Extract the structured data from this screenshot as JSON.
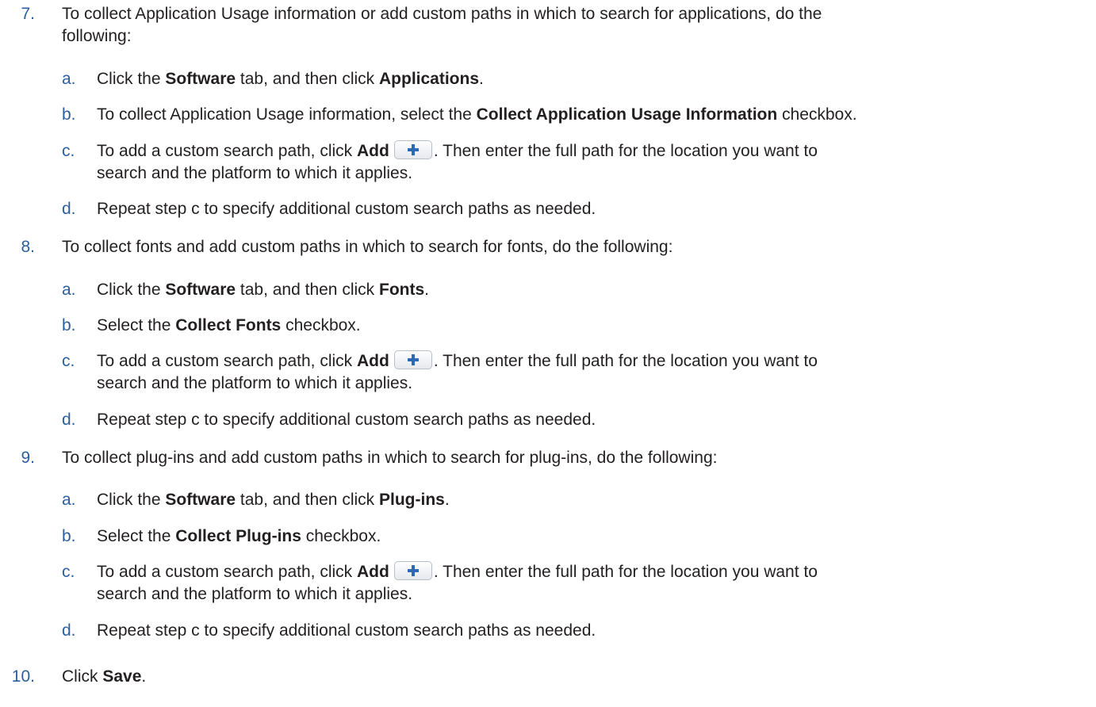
{
  "steps": [
    {
      "num": "7.",
      "text": "To collect Application Usage information or add custom paths in which to search for applications, do the",
      "text2": "following:",
      "subs": [
        {
          "letter": "a.",
          "p1": "Click the ",
          "b1": "Software",
          "p2": " tab, and then click ",
          "b2": "Applications",
          "p3": "."
        },
        {
          "letter": "b.",
          "p1": "To collect Application Usage information, select the ",
          "b1": "Collect Application Usage Information",
          "p2": " checkbox."
        },
        {
          "letter": "c.",
          "p1": "To add a custom search path, click ",
          "b1": "Add",
          "p2": ". Then enter the full path for the location you want to",
          "p3": "search and the platform to which it applies."
        },
        {
          "letter": "d.",
          "p1": "Repeat step c to specify additional custom search paths as needed."
        }
      ]
    },
    {
      "num": "8.",
      "text": "To collect fonts and add custom paths in which to search for fonts, do the following:",
      "subs": [
        {
          "letter": "a.",
          "p1": "Click the ",
          "b1": "Software",
          "p2": " tab, and then click ",
          "b2": "Fonts",
          "p3": "."
        },
        {
          "letter": "b.",
          "p1": "Select the ",
          "b1": "Collect Fonts",
          "p2": " checkbox."
        },
        {
          "letter": "c.",
          "p1": "To add a custom search path, click ",
          "b1": "Add",
          "p2": ". Then enter the full path for the location you want to",
          "p3": "search and the platform to which it applies."
        },
        {
          "letter": "d.",
          "p1": "Repeat step c to specify additional custom search paths as needed."
        }
      ]
    },
    {
      "num": "9.",
      "text": "To collect plug-ins and add custom paths in which to search for plug-ins, do the following:",
      "subs": [
        {
          "letter": "a.",
          "p1": "Click the ",
          "b1": "Software",
          "p2": " tab, and then click ",
          "b2": "Plug-ins",
          "p3": "."
        },
        {
          "letter": "b.",
          "p1": "Select the ",
          "b1": "Collect Plug-ins",
          "p2": " checkbox."
        },
        {
          "letter": "c.",
          "p1": "To add a custom search path, click ",
          "b1": "Add",
          "p2": ". Then enter the full path for the location you want to",
          "p3": "search and the platform to which it applies."
        },
        {
          "letter": "d.",
          "p1": "Repeat step c to specify additional custom search paths as needed."
        }
      ]
    },
    {
      "num": "10.",
      "p1": "Click ",
      "b1": "Save",
      "p2": "."
    }
  ],
  "icons": {
    "add": "plus-icon"
  },
  "colors": {
    "number": "#2c5f9e",
    "plus": "#2a6ab8",
    "text": "#231f20"
  }
}
